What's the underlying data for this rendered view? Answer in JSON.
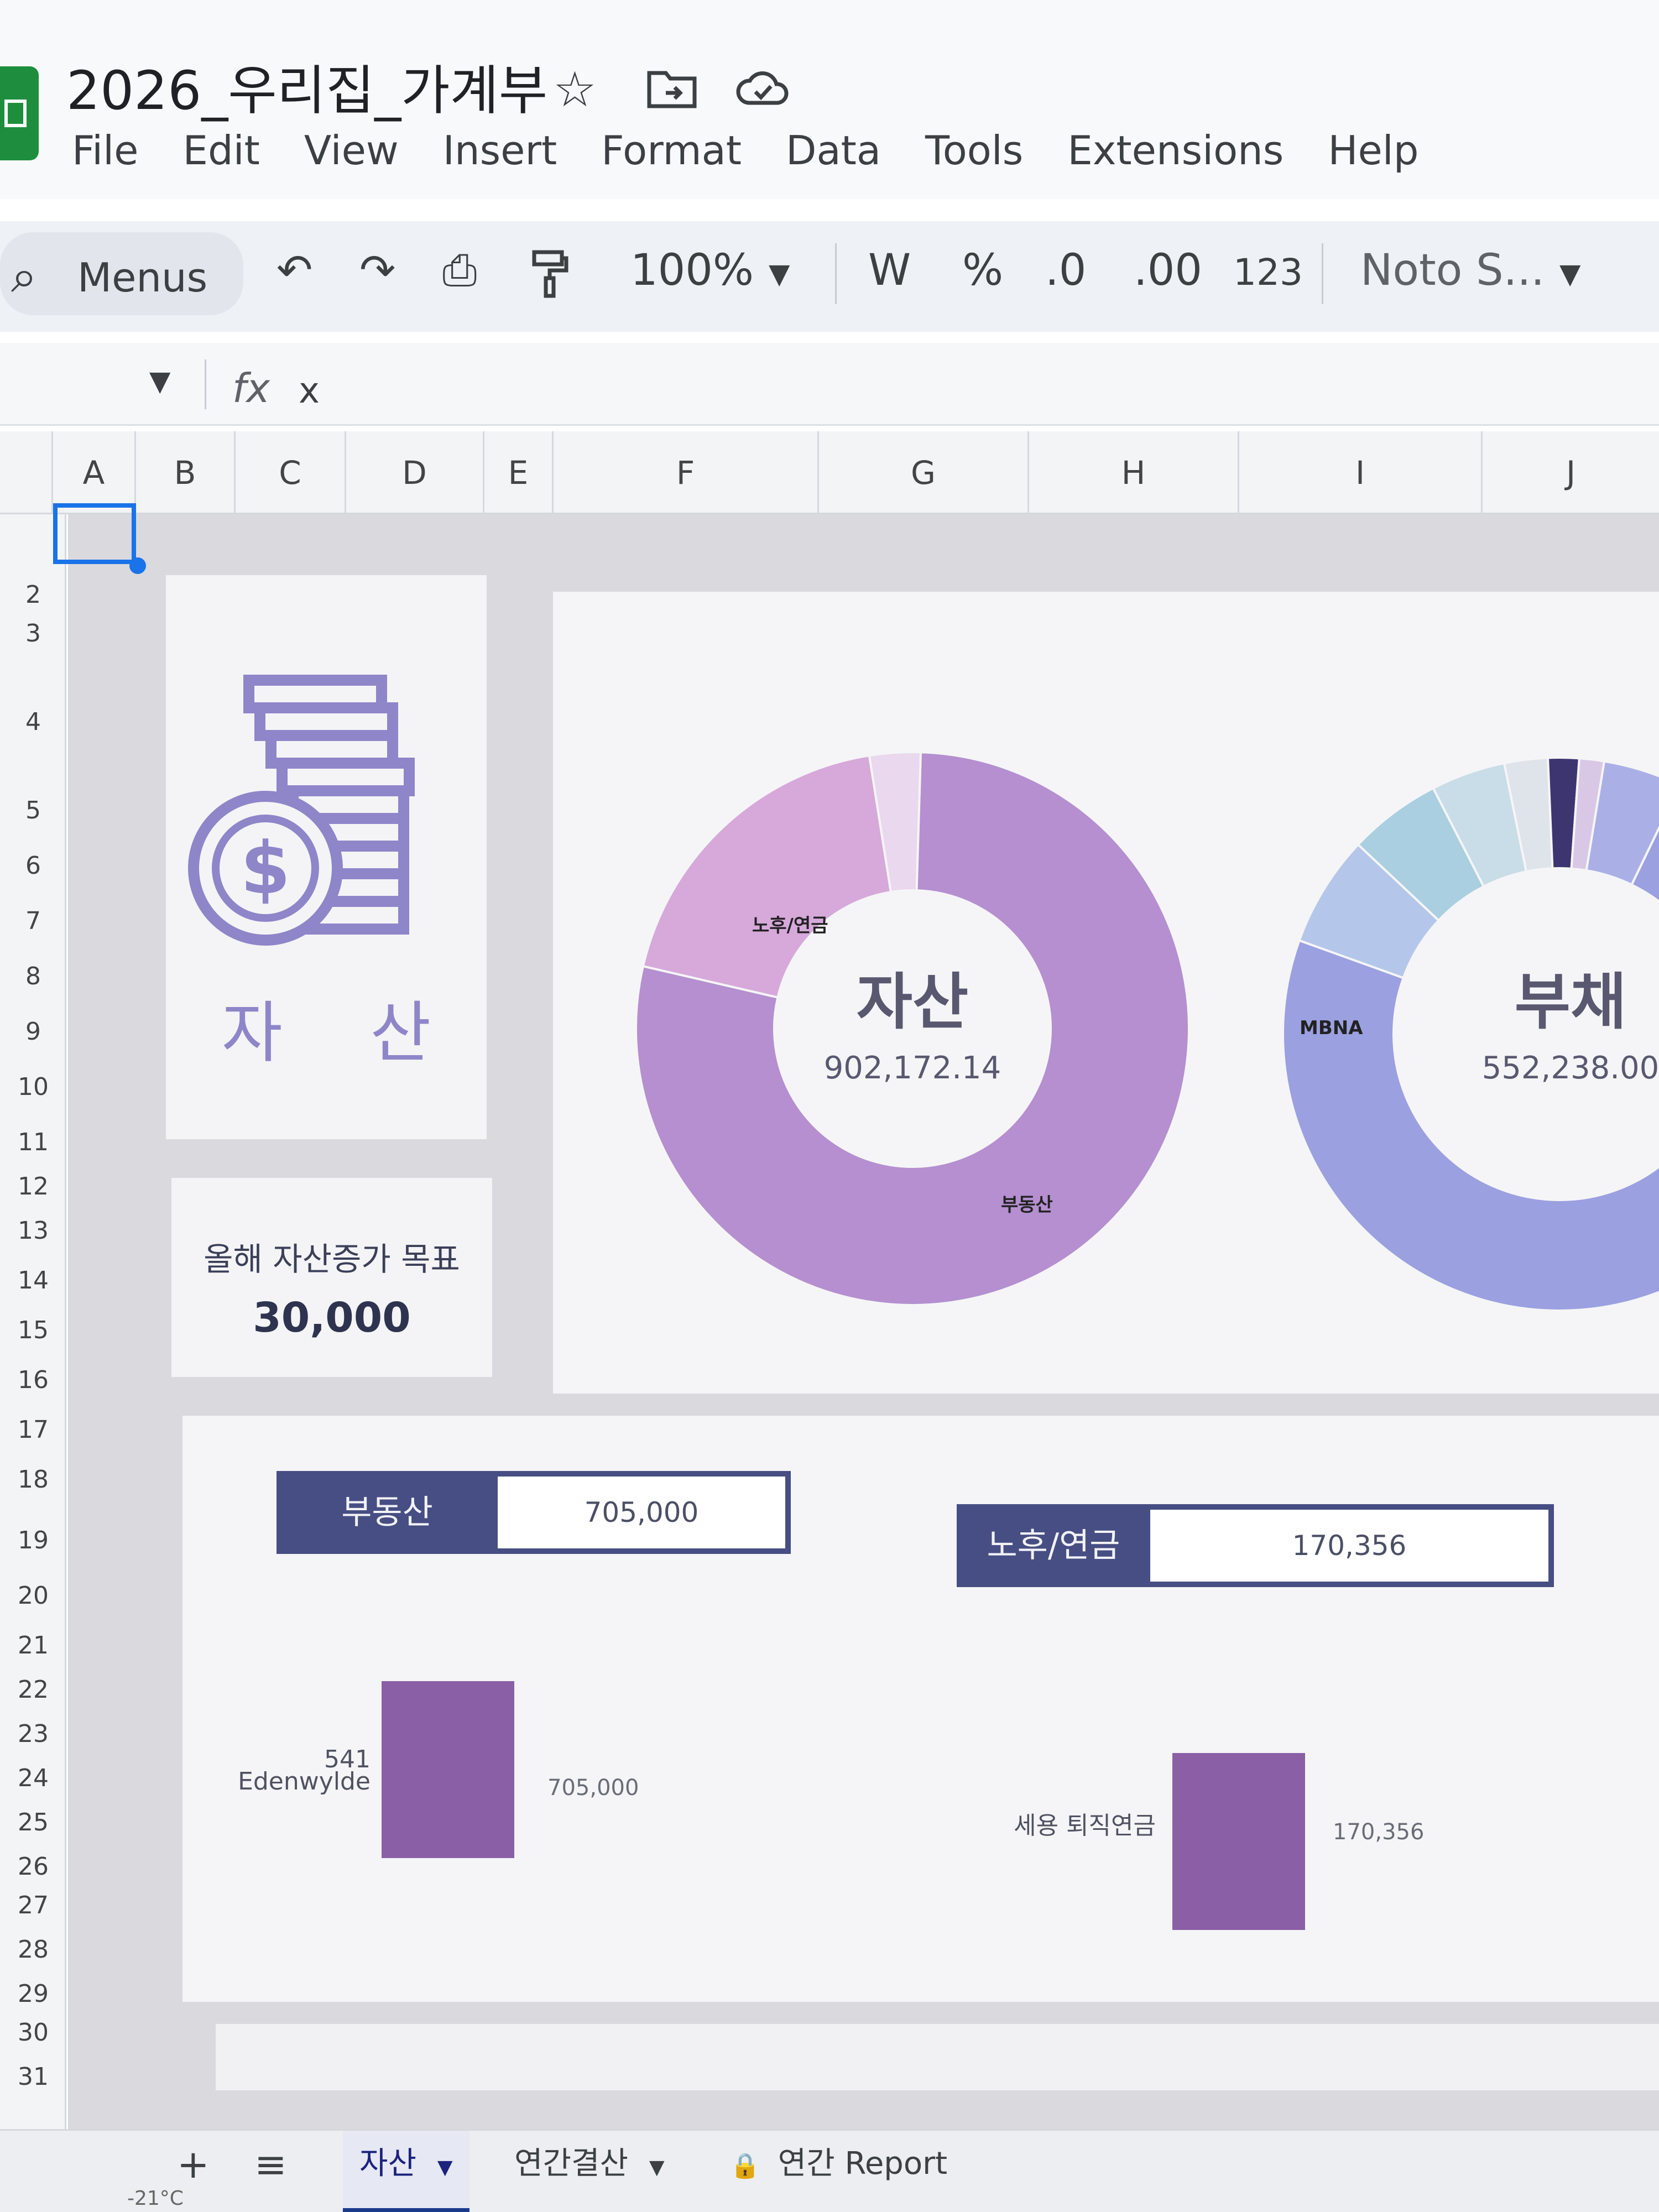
{
  "app": {
    "document_title": "2026_우리집_가계부",
    "menu": [
      "File",
      "Edit",
      "View",
      "Insert",
      "Format",
      "Data",
      "Tools",
      "Extensions",
      "Help"
    ]
  },
  "toolbar": {
    "search_label": "Menus",
    "zoom": "100%",
    "currency_symbol": "W",
    "percent_symbol": "%",
    "decrease_decimal": ".0",
    "increase_decimal": ".00",
    "number_format": "123",
    "font_name": "Noto S..."
  },
  "formula_bar": {
    "fx_label": "fx",
    "value": "x"
  },
  "grid": {
    "columns": [
      "A",
      "B",
      "C",
      "D",
      "E",
      "F",
      "G",
      "H",
      "I",
      "J"
    ],
    "rows": [
      "2",
      "3",
      "4",
      "5",
      "6",
      "7",
      "8",
      "9",
      "10",
      "11",
      "12",
      "13",
      "14",
      "15",
      "16",
      "17",
      "18",
      "19",
      "20",
      "21",
      "22",
      "23",
      "24",
      "25",
      "26",
      "27",
      "28",
      "29",
      "30",
      "31"
    ]
  },
  "dashboard": {
    "asset_title": "자 산",
    "goal_label": "올해 자산증가 목표",
    "goal_value": "30,000",
    "kpis": [
      {
        "label": "부동산",
        "value": "705,000"
      },
      {
        "label": "노후/연금",
        "value": "170,356"
      }
    ],
    "bars": [
      {
        "label_line1": "541",
        "label_line2": "Edenwylde",
        "value_label": "705,000"
      },
      {
        "label_line1": "세용 퇴직연금",
        "label_line2": "",
        "value_label": "170,356"
      }
    ],
    "colors": {
      "accent_navy": "#474e83",
      "donut_purple": "#b58fd0",
      "donut_pink": "#d6a9da",
      "donut_blue": "#9aa0e0",
      "bar_purple": "#8a5fa6",
      "logo_purple": "#8f85c9"
    }
  },
  "chart_data": [
    {
      "type": "pie",
      "title": "자산",
      "center_value": "902,172.14",
      "slices": [
        {
          "label": "부동산",
          "value": 705000
        },
        {
          "label": "노후/연금",
          "value": 170356
        },
        {
          "label": "",
          "value": 26816.14
        }
      ]
    },
    {
      "type": "pie",
      "title": "부채",
      "center_value": "552,238.00",
      "slices": [
        {
          "label": "",
          "value": 405000
        },
        {
          "label": "MBNA",
          "value": 36000
        },
        {
          "label": "",
          "value": 30000
        },
        {
          "label": "",
          "value": 24000
        },
        {
          "label": "",
          "value": 14000
        },
        {
          "label": "",
          "value": 10000
        },
        {
          "label": "",
          "value": 8000
        },
        {
          "label": "",
          "value": 25238
        }
      ]
    },
    {
      "type": "bar",
      "categories": [
        "541 Edenwylde"
      ],
      "values": [
        705000
      ]
    },
    {
      "type": "bar",
      "categories": [
        "세용 퇴직연금"
      ],
      "values": [
        170356
      ]
    }
  ],
  "sheet_tabs": {
    "add": "+",
    "all": "≡",
    "tabs": [
      "자산",
      "연간결산",
      "연간 Report"
    ],
    "weather": "-21°C"
  }
}
